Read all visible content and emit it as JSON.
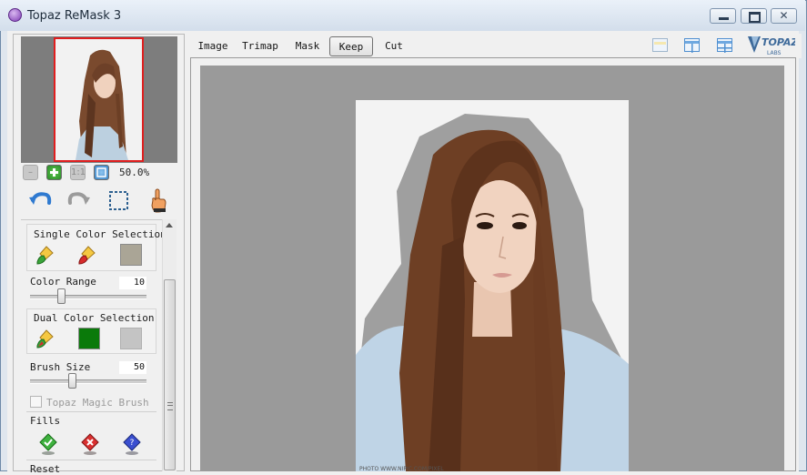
{
  "window": {
    "title": "Topaz ReMask 3",
    "controls": {
      "minimize": "minimize",
      "maximize": "maximize",
      "close": "✕"
    }
  },
  "navigator": {
    "zoom": "50.0%"
  },
  "toolbar": {
    "tabs": [
      {
        "label": "Image",
        "active": false
      },
      {
        "label": "Trimap",
        "active": false
      },
      {
        "label": "Mask",
        "active": false
      },
      {
        "label": "Keep",
        "active": true
      },
      {
        "label": "Cut",
        "active": false
      }
    ],
    "logo_text": "TOPAZ",
    "logo_sub": "LABS"
  },
  "panel": {
    "single_color": {
      "title": "Single Color Selection",
      "swatch": "#aaa596"
    },
    "color_range": {
      "label": "Color Range",
      "value": "10",
      "fraction": 0.1
    },
    "dual_color": {
      "title": "Dual Color Selection",
      "swatch1": "#0a7a0a",
      "swatch2": "#c4c4c4"
    },
    "brush_size": {
      "label": "Brush Size",
      "value": "50",
      "fraction": 0.2
    },
    "magic_brush": {
      "label": "Topaz Magic Brush",
      "checked": false
    },
    "fills_label": "Fills",
    "reset_label": "Reset"
  },
  "canvas": {
    "background": "#9a9a9a",
    "credit": "PHOTO WWW.NIPIC.COM/PIXEL"
  },
  "colors": {
    "accent": "#e01e1e",
    "keep_overlay": "#8f8f8f"
  }
}
